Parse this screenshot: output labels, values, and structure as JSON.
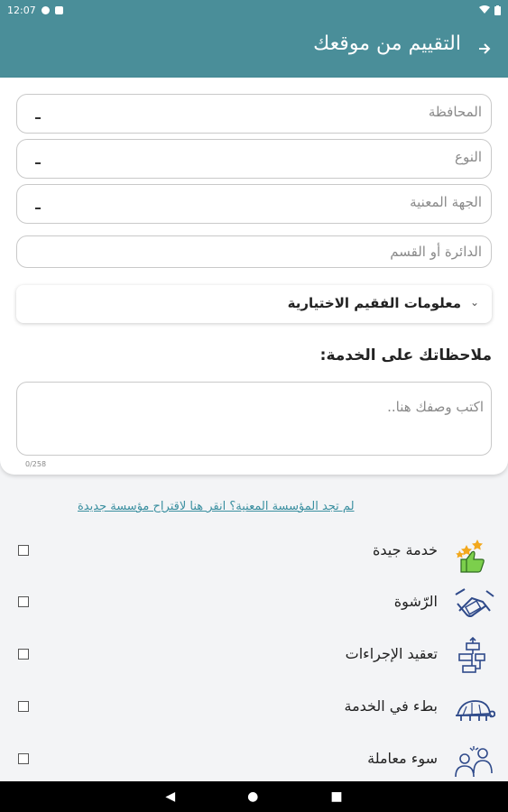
{
  "status_bar": {
    "time": "12:07"
  },
  "header": {
    "title": "التقييم من موقعك",
    "back_icon": "arrow-forward-icon"
  },
  "form": {
    "governorate_placeholder": "المحافظة",
    "type_placeholder": "النوع",
    "agency_placeholder": "الجهة المعنية",
    "department_placeholder": "الدائرة أو القسم",
    "optional_info_label": "معلومات الفقيم الاختيارية",
    "notes_heading": "ملاحظاتك على الخدمة:",
    "notes_placeholder": "اكتب وصفك هنا..",
    "notes_counter": "0/258"
  },
  "suggest_link": "لم تجد المؤسسة المعنية؟ انقر هنا لاقتراح مؤسسة جديدة",
  "ratings": [
    {
      "label": "خدمة جيدة",
      "icon": "thumbs-up-stars-icon"
    },
    {
      "label": "الرّشوة",
      "icon": "handshake-money-icon"
    },
    {
      "label": "تعقيد الإجراءات",
      "icon": "flowchart-icon"
    },
    {
      "label": "بطء في الخدمة",
      "icon": "turtle-icon"
    },
    {
      "label": "سوء معاملة",
      "icon": "people-dispute-icon"
    }
  ],
  "colors": {
    "primary": "#4a8e99",
    "accent_link": "#3a8fa0",
    "icon_green": "#5aaa3a",
    "icon_blue": "#2f4a8a"
  }
}
